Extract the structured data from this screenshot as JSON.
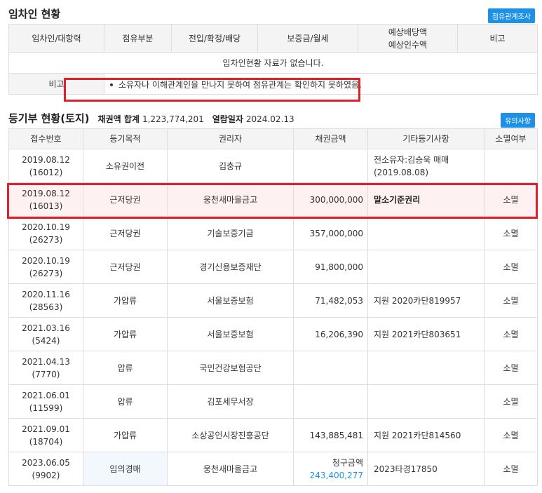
{
  "tenant": {
    "title": "임차인 현황",
    "button": "점유관계조사",
    "headers": [
      "임차인/대항력",
      "점유부분",
      "전입/확정/배당",
      "보증금/월세",
      "예상배당액\n예상인수액",
      "비고"
    ],
    "empty_message": "임차인현황 자료가 없습니다.",
    "note_label": "비고",
    "note_text": "소유자나 이해관계인을 만나지 못하여 점유관계는 확인하지 못하였음."
  },
  "registry": {
    "title": "등기부 현황(토지)",
    "claim_sum_label": "채권액 합계",
    "claim_sum_value": "1,223,774,201",
    "view_date_label": "열람일자",
    "view_date_value": "2024.02.13",
    "button": "유의사항",
    "headers": [
      "접수번호",
      "등기목적",
      "권리자",
      "채권금액",
      "기타등기사항",
      "소멸여부"
    ],
    "rows": [
      {
        "date": "2019.08.12",
        "no": "(16012)",
        "purpose": "소유권이전",
        "holder": "김충규",
        "amount": "",
        "etc": "전소유자:김승욱 매매(2019.08.08)",
        "status": ""
      },
      {
        "date": "2019.08.12",
        "no": "(16013)",
        "purpose": "근저당권",
        "holder": "웅천새마을금고",
        "amount": "300,000,000",
        "etc": "말소기준권리",
        "status": "소멸"
      },
      {
        "date": "2020.10.19",
        "no": "(26273)",
        "purpose": "근저당권",
        "holder": "기술보증기금",
        "amount": "357,000,000",
        "etc": "",
        "status": "소멸"
      },
      {
        "date": "2020.10.19",
        "no": "(26273)",
        "purpose": "근저당권",
        "holder": "경기신용보증재단",
        "amount": "91,800,000",
        "etc": "",
        "status": "소멸"
      },
      {
        "date": "2020.11.16",
        "no": "(28563)",
        "purpose": "가압류",
        "holder": "서울보증보험",
        "amount": "71,482,053",
        "etc": "지원 2020카단819957",
        "status": "소멸"
      },
      {
        "date": "2021.03.16",
        "no": "(5424)",
        "purpose": "가압류",
        "holder": "서울보증보험",
        "amount": "16,206,390",
        "etc": "지원 2021카단803651",
        "status": "소멸"
      },
      {
        "date": "2021.04.13",
        "no": "(7770)",
        "purpose": "압류",
        "holder": "국민건강보험공단",
        "amount": "",
        "etc": "",
        "status": "소멸"
      },
      {
        "date": "2021.06.01",
        "no": "(11599)",
        "purpose": "압류",
        "holder": "김포세무서장",
        "amount": "",
        "etc": "",
        "status": "소멸"
      },
      {
        "date": "2021.09.01",
        "no": "(18704)",
        "purpose": "가압류",
        "holder": "소상공인시장진흥공단",
        "amount": "143,885,481",
        "etc": "지원 2021카단814560",
        "status": "소멸"
      },
      {
        "date": "2023.06.05",
        "no": "(9902)",
        "purpose": "임의경매",
        "holder": "웅천새마을금고",
        "amount_label": "청구금액",
        "amount": "243,400,277",
        "etc": "2023타경17850",
        "status": "소멸"
      }
    ]
  }
}
